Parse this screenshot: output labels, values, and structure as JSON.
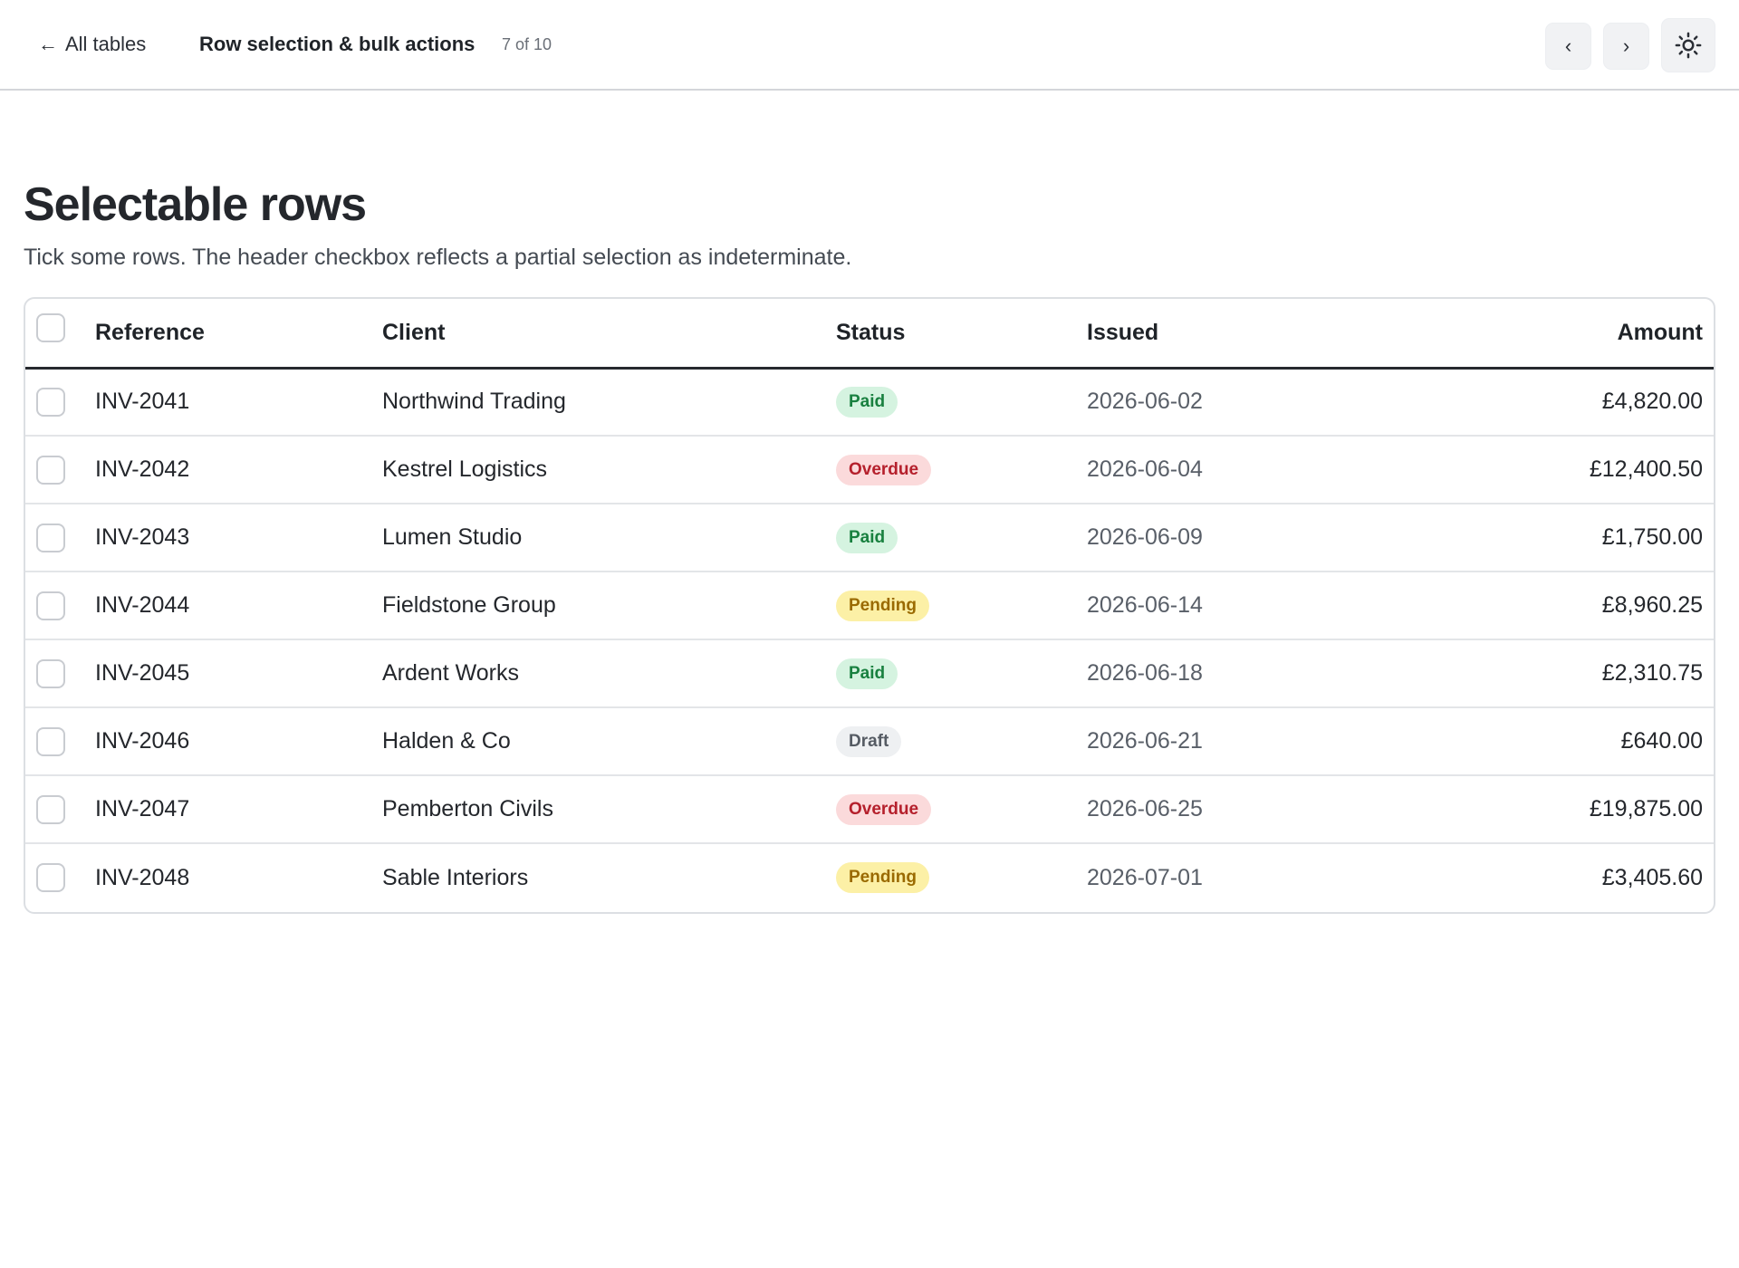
{
  "topbar": {
    "back_label": "All tables",
    "context_title": "Row selection & bulk actions",
    "counter": "7 of 10",
    "prev_label": "‹",
    "next_label": "›",
    "theme_icon": "sun-icon"
  },
  "page": {
    "title": "Selectable rows",
    "description": "Tick some rows. The header checkbox reflects a partial selection as indeterminate."
  },
  "table": {
    "columns": [
      "Reference",
      "Client",
      "Status",
      "Issued",
      "Amount"
    ],
    "rows": [
      {
        "reference": "INV-2041",
        "client": "Northwind Trading",
        "status": "Paid",
        "status_kind": "paid",
        "issued": "2026-06-02",
        "amount": "£4,820.00"
      },
      {
        "reference": "INV-2042",
        "client": "Kestrel Logistics",
        "status": "Overdue",
        "status_kind": "overdue",
        "issued": "2026-06-04",
        "amount": "£12,400.50"
      },
      {
        "reference": "INV-2043",
        "client": "Lumen Studio",
        "status": "Paid",
        "status_kind": "paid",
        "issued": "2026-06-09",
        "amount": "£1,750.00"
      },
      {
        "reference": "INV-2044",
        "client": "Fieldstone Group",
        "status": "Pending",
        "status_kind": "pending",
        "issued": "2026-06-14",
        "amount": "£8,960.25"
      },
      {
        "reference": "INV-2045",
        "client": "Ardent Works",
        "status": "Paid",
        "status_kind": "paid",
        "issued": "2026-06-18",
        "amount": "£2,310.75"
      },
      {
        "reference": "INV-2046",
        "client": "Halden & Co",
        "status": "Draft",
        "status_kind": "draft",
        "issued": "2026-06-21",
        "amount": "£640.00"
      },
      {
        "reference": "INV-2047",
        "client": "Pemberton Civils",
        "status": "Overdue",
        "status_kind": "overdue",
        "issued": "2026-06-25",
        "amount": "£19,875.00"
      },
      {
        "reference": "INV-2048",
        "client": "Sable Interiors",
        "status": "Pending",
        "status_kind": "pending",
        "issued": "2026-07-01",
        "amount": "£3,405.60"
      }
    ]
  },
  "colors": {
    "paid_bg": "#d5f3e0",
    "paid_fg": "#18803f",
    "overdue_bg": "#fbdadb",
    "overdue_fg": "#b5202c",
    "pending_bg": "#fcf0a6",
    "pending_fg": "#9a6a00",
    "draft_bg": "#eef0f2",
    "draft_fg": "#555b63"
  }
}
